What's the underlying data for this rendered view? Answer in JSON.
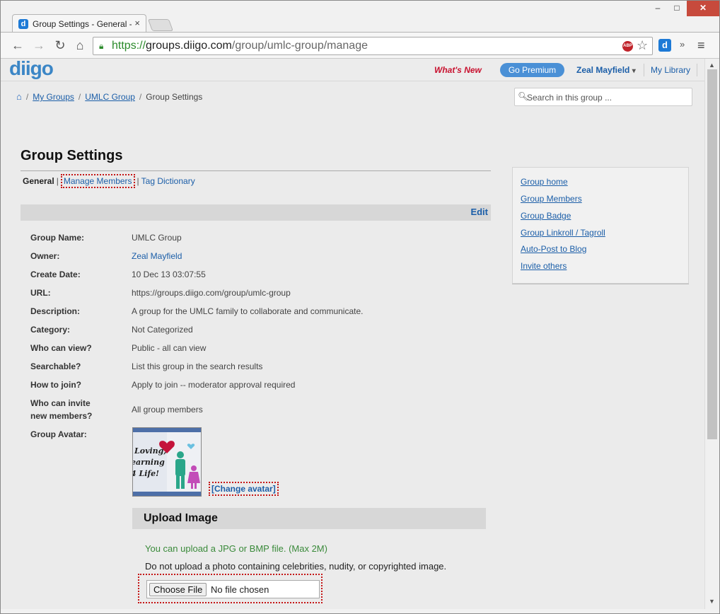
{
  "window": {
    "tab_title": "Group Settings - General -",
    "tab_close": "×",
    "minimize": "–",
    "maximize": "□",
    "close": "✕"
  },
  "toolbar": {
    "url_scheme": "https://",
    "url_host": "groups.diigo.com",
    "url_path": "/group/umlc-group/manage",
    "abp_label": "ABP",
    "more_label": "»"
  },
  "site": {
    "logo": "diigo",
    "whats_new": "What's New",
    "go_premium": "Go Premium",
    "user_name": "Zeal Mayfield",
    "user_caret": "▾",
    "my_library": "My Library"
  },
  "breadcrumb": {
    "items": [
      "My Groups",
      "UMLC Group"
    ],
    "current": "Group Settings",
    "separator": "/"
  },
  "search": {
    "placeholder": "Search in this group ..."
  },
  "page": {
    "title": "Group Settings",
    "subnav": {
      "general": "General",
      "manage_members": "Manage Members",
      "tag_dictionary": "Tag Dictionary",
      "sep": "|"
    },
    "edit": "Edit"
  },
  "details": [
    {
      "label": "Group Name:",
      "value": "UMLC Group"
    },
    {
      "label": "Owner:",
      "value": "Zeal Mayfield"
    },
    {
      "label": "Create Date:",
      "value": "10 Dec 13 03:07:55"
    },
    {
      "label": "URL:",
      "value": "https://groups.diigo.com/group/umlc-group"
    },
    {
      "label": "Description:",
      "value": "A group for the UMLC family to collaborate and communicate."
    },
    {
      "label": "Category:",
      "value": "Not Categorized"
    },
    {
      "label": "Who can view?",
      "value": "Public - all can view"
    },
    {
      "label": "Searchable?",
      "value": "List this group in the search results"
    },
    {
      "label": "How to join?",
      "value": "Apply to join -- moderator approval required"
    },
    {
      "label": "Who can invite new members?",
      "value": "All group members"
    },
    {
      "label": "Group Avatar:",
      "value": ""
    }
  ],
  "avatar": {
    "line1": "Loving,",
    "line2": "earning",
    "line3": "4 Life!",
    "change": "[Change avatar]"
  },
  "upload": {
    "heading": "Upload Image",
    "hint": "You can upload a JPG or BMP file. (Max 2M)",
    "warning": "Do not upload a photo containing celebrities, nudity, or copyrighted image.",
    "choose_file": "Choose File",
    "no_file": "No file chosen"
  },
  "sidebar": {
    "links": [
      "Group home",
      "Group Members",
      "Group Badge",
      "Group Linkroll / Tagroll",
      "Auto-Post to Blog",
      "Invite others"
    ]
  },
  "colors": {
    "link": "#1b5ea8",
    "whats_new": "#c8102e",
    "premium": "#4a90d6",
    "highlight_border": "#c51616",
    "upload_hint": "#3a8a3a"
  }
}
